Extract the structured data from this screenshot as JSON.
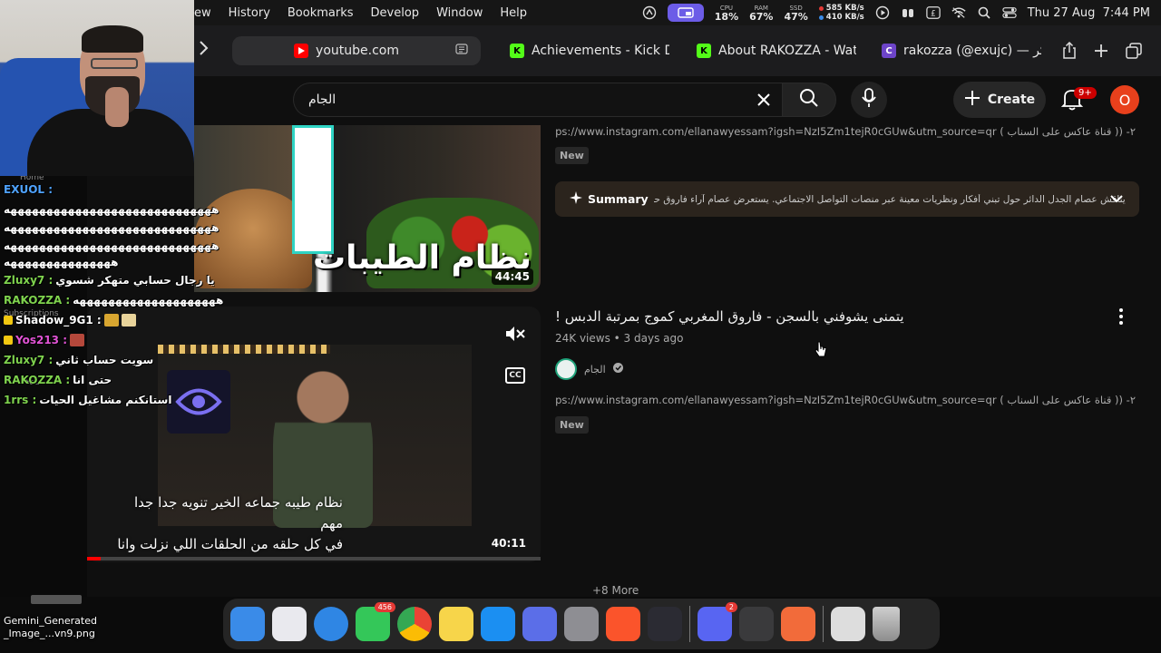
{
  "menubar": {
    "menus": [
      "ew",
      "History",
      "Bookmarks",
      "Develop",
      "Window",
      "Help"
    ],
    "cpu_label": "CPU",
    "cpu_value": "18%",
    "ram_label": "RAM",
    "ram_value": "67%",
    "ssd_label": "SSD",
    "ssd_value": "47%",
    "net_up": "585 KB/s",
    "net_down": "410 KB/s",
    "clock": "Thu 27 Aug  7:44 PM",
    "icons": [
      "activity-icon",
      "screen-share-icon",
      "play-icon",
      "walkie-icon",
      "currency-icon",
      "wifi-icon",
      "search-icon",
      "control-center-icon"
    ]
  },
  "browser": {
    "tabs": [
      {
        "label": "youtube.com",
        "favicon": "youtube-icon",
        "active": true
      },
      {
        "label": "Achievements - Kick D...",
        "favicon": "kick-icon"
      },
      {
        "label": "About RAKOZZA - Wat...",
        "favicon": "kick-icon"
      },
      {
        "label": "rakozza (@exujc) — کر...",
        "favicon": "site-icon"
      }
    ]
  },
  "youtube": {
    "search_value": "الجام",
    "create_label": "Create",
    "notification_count": "9+",
    "avatar_letter": "O"
  },
  "video1": {
    "thumb_title": "نظام الطيبات",
    "duration": "44:45",
    "desc": "٢- (( قناة عاكس على السناب ) https://www.instagram.com/ellanawyessam?igsh=NzI5Zm1tejR0cGUw&utm_source=qr الانستقرام",
    "new_tag": "New",
    "summary_label": "Summary",
    "summary_text": "يناقش عصام الجدل الدائر حول تبني أفكار ونظريات معينة عبر منصات التواصل الاجتماعي. يستعرض عصام آراء فاروق حول نظام"
  },
  "video2": {
    "title": "يتمنى يشوفني بالسجن - فاروق المغربي كموج بمرتبة الدبس !",
    "meta": "24K views • 3 days ago",
    "channel": "الجام",
    "desc": "٢- (( قناة عاكس على السناب ) https://www.instagram.com/ellanawyessam?igsh=NzI5Zm1tejR0cGUw&utm_source=qr الانستقرام",
    "new_tag": "New",
    "caption_line1": "نظام طيبه جماعه الخير تنويه جدا جدا مهم",
    "caption_line2": "في كل حلقه من الحلقات اللي نزلت وانا",
    "duration": "40:11",
    "cc_label": "CC",
    "progress": 0.03
  },
  "more_label": "+8 More",
  "sidebar_ghost": [
    "Home",
    "Subscriptions",
    "You"
  ],
  "chat": [
    {
      "user": "EXUOL",
      "sep": " :",
      "text": "",
      "color": "#4fa3ff"
    },
    {
      "user": "",
      "sep": "",
      "text": "هههههههههههههههههههههههههههههه",
      "color": "#fff"
    },
    {
      "user": "",
      "sep": "",
      "text": "هههههههههههههههههههههههههههههه",
      "color": "#fff"
    },
    {
      "user": "",
      "sep": "",
      "text": "هههههههههههههههههههههههههههههه",
      "color": "#fff"
    },
    {
      "user": "",
      "sep": "",
      "text": "هههههههههههههههه",
      "color": "#fff"
    },
    {
      "user": "Zluxy7",
      "sep": " :",
      "text": "يا رجال حسابي متهكر شسوي",
      "color": "#7fd34e"
    },
    {
      "user": "RAKOZZA",
      "sep": " :",
      "text": "ههههههههههههههههههههه",
      "color": "#7fd34e"
    },
    {
      "user": "Shadow_9G1",
      "sep": " :",
      "text": "",
      "color": "#fff"
    },
    {
      "user": "Yos213",
      "sep": " :",
      "text": "",
      "color": "#e254d6"
    },
    {
      "user": "Zluxy7",
      "sep": " :",
      "text": "سويت حساب ثاني",
      "color": "#7fd34e"
    },
    {
      "user": "RAKOZZA",
      "sep": " :",
      "text": "حتى انا",
      "color": "#7fd34e"
    },
    {
      "user": "1rrs",
      "sep": " :",
      "text": "استانكنم مشاغيل الحيات",
      "color": "#7fd34e"
    }
  ],
  "dock": {
    "apps": [
      {
        "name": "finder-icon",
        "color": "#3a8be8"
      },
      {
        "name": "launchpad-icon",
        "color": "#e9e9ee"
      },
      {
        "name": "safari-icon",
        "color": "#2f86e4"
      },
      {
        "name": "messages-icon",
        "color": "#34c759",
        "badge": "456"
      },
      {
        "name": "chrome-icon",
        "color": "#ffffff"
      },
      {
        "name": "notes-icon",
        "color": "#f7d54a"
      },
      {
        "name": "app-store-icon",
        "color": "#1b8ff2"
      },
      {
        "name": "simulator-icon",
        "color": "#5b6ee8"
      },
      {
        "name": "settings-icon",
        "color": "#8e8e93"
      },
      {
        "name": "brave-icon",
        "color": "#fb542b"
      },
      {
        "name": "obs-icon",
        "color": "#2b2b33"
      },
      {
        "name": "discord-icon",
        "color": "#5865f2",
        "badge": "2"
      },
      {
        "name": "calculator-icon",
        "color": "#3a3a3c"
      },
      {
        "name": "claude-icon",
        "color": "#f26b3a"
      },
      {
        "name": "downloads-stack-icon",
        "color": "#dddddd"
      },
      {
        "name": "trash-icon",
        "color": "#9a9a9a"
      }
    ]
  },
  "desktop_file": {
    "line1": "Gemini_Generated",
    "line2": "_Image_...vn9.png"
  }
}
